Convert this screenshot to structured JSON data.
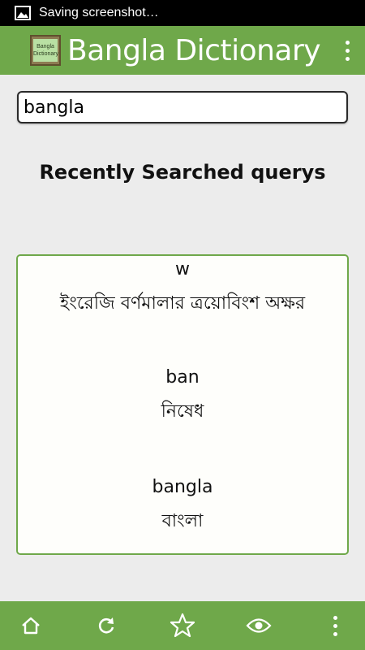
{
  "status_bar": {
    "notification_icon": "image-icon",
    "text": "Saving screenshot…"
  },
  "app_bar": {
    "logo_text_line1": "Bangla",
    "logo_text_line2": "Dictionary",
    "title": "Bangla Dictionary",
    "overflow_icon": "more-vertical-icon"
  },
  "search": {
    "value": "bangla",
    "placeholder": ""
  },
  "recent": {
    "heading": "Recently Searched querys",
    "items": [
      {
        "word": "w",
        "meaning": "ইংরেজি বর্ণমালার ত্রয়োবিংশ অক্ষর"
      },
      {
        "word": "ban",
        "meaning": "নিষেধ"
      },
      {
        "word": "bangla",
        "meaning": "বাংলা"
      }
    ]
  },
  "bottom_bar": {
    "icons": [
      "home-icon",
      "refresh-icon",
      "star-icon",
      "eye-icon",
      "more-vertical-icon"
    ]
  },
  "colors": {
    "accent": "#6fa84a",
    "background": "#ececec",
    "card_background": "#fefefb"
  }
}
